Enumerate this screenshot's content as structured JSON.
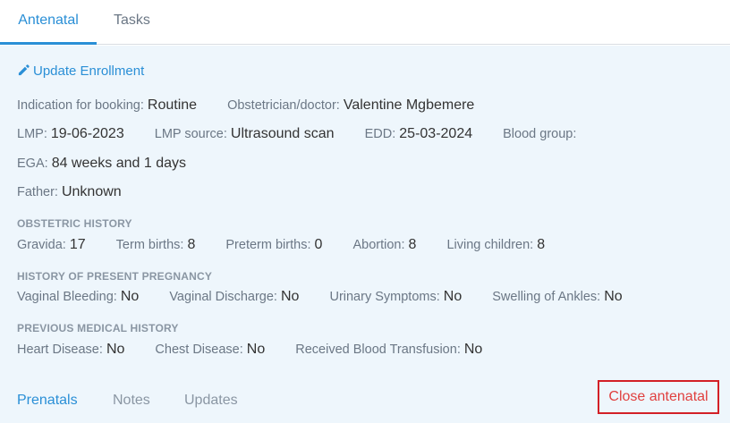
{
  "tabs": {
    "antenatal": "Antenatal",
    "tasks": "Tasks"
  },
  "actions": {
    "update_enrollment": "Update Enrollment",
    "close_antenatal": "Close antenatal"
  },
  "enrollment": {
    "indication_label": "Indication for booking:",
    "indication_value": "Routine",
    "obstetrician_label": "Obstetrician/doctor:",
    "obstetrician_value": "Valentine Mgbemere",
    "lmp_label": "LMP:",
    "lmp_value": "19-06-2023",
    "lmp_source_label": "LMP source:",
    "lmp_source_value": "Ultrasound scan",
    "edd_label": "EDD:",
    "edd_value": "25-03-2024",
    "blood_group_label": "Blood group:",
    "blood_group_value": "",
    "ega_label": "EGA:",
    "ega_value": "84 weeks and 1 days",
    "father_label": "Father:",
    "father_value": "Unknown"
  },
  "obstetric_history": {
    "title": "OBSTETRIC HISTORY",
    "gravida_label": "Gravida:",
    "gravida_value": "17",
    "term_births_label": "Term births:",
    "term_births_value": "8",
    "preterm_births_label": "Preterm births:",
    "preterm_births_value": "0",
    "abortion_label": "Abortion:",
    "abortion_value": "8",
    "living_children_label": "Living children:",
    "living_children_value": "8"
  },
  "present_pregnancy": {
    "title": "HISTORY OF PRESENT PREGNANCY",
    "vaginal_bleeding_label": "Vaginal Bleeding:",
    "vaginal_bleeding_value": "No",
    "vaginal_discharge_label": "Vaginal Discharge:",
    "vaginal_discharge_value": "No",
    "urinary_symptoms_label": "Urinary Symptoms:",
    "urinary_symptoms_value": "No",
    "swelling_ankles_label": "Swelling of Ankles:",
    "swelling_ankles_value": "No"
  },
  "medical_history": {
    "title": "PREVIOUS MEDICAL HISTORY",
    "heart_disease_label": "Heart Disease:",
    "heart_disease_value": "No",
    "chest_disease_label": "Chest Disease:",
    "chest_disease_value": "No",
    "blood_transfusion_label": "Received Blood Transfusion:",
    "blood_transfusion_value": "No"
  },
  "bottom_tabs": {
    "prenatals": "Prenatals",
    "notes": "Notes",
    "updates": "Updates"
  },
  "colors": {
    "accent": "#2a8fd6",
    "panel_bg": "#eef6fc",
    "close_red": "#d32027"
  },
  "icons": {
    "update": "pencil-icon"
  }
}
